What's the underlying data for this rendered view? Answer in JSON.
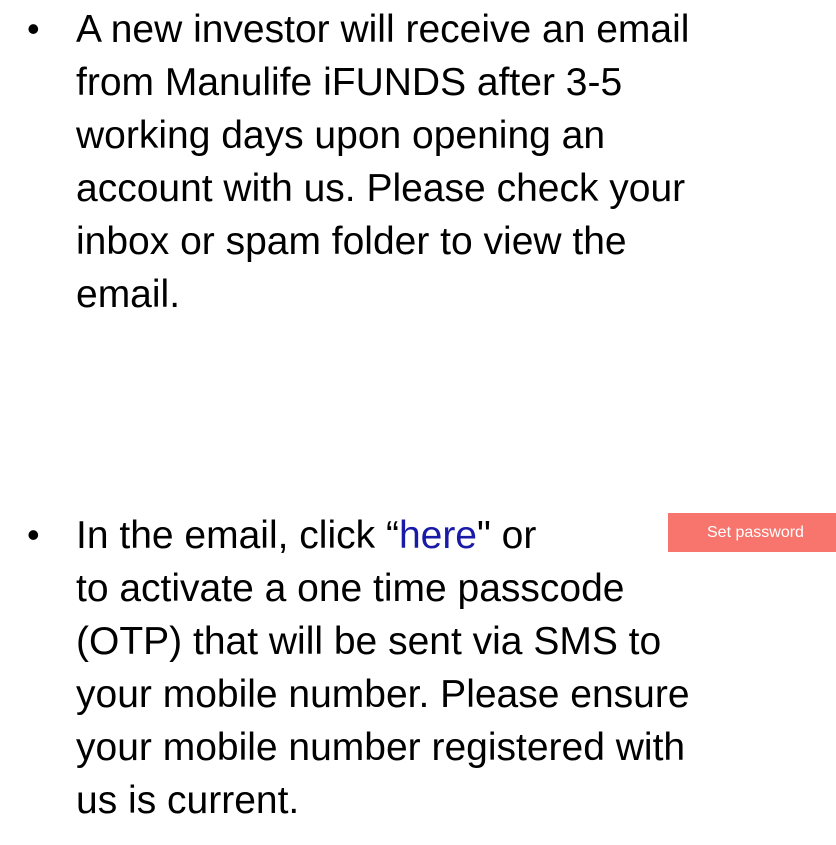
{
  "bullet_char": "•",
  "item1": {
    "lines": [
      "A new investor will receive an email",
      "from Manulife iFUNDS after 3-5",
      "working days upon opening an",
      "account with us. Please check your",
      "inbox or spam folder to view the",
      "email."
    ]
  },
  "item2": {
    "line1_prefix": "In the email, click “",
    "link_text": "here",
    "line1_suffix": "\" or",
    "button_label": "Set password",
    "lines": [
      "to activate a one time passcode",
      "(OTP) that will be sent via SMS to",
      "your mobile number. Please ensure",
      "your mobile number registered with",
      "us is current."
    ]
  },
  "colors": {
    "link": "#1a1aa8",
    "button_bg": "#f7756c",
    "button_text": "#ffffff"
  }
}
